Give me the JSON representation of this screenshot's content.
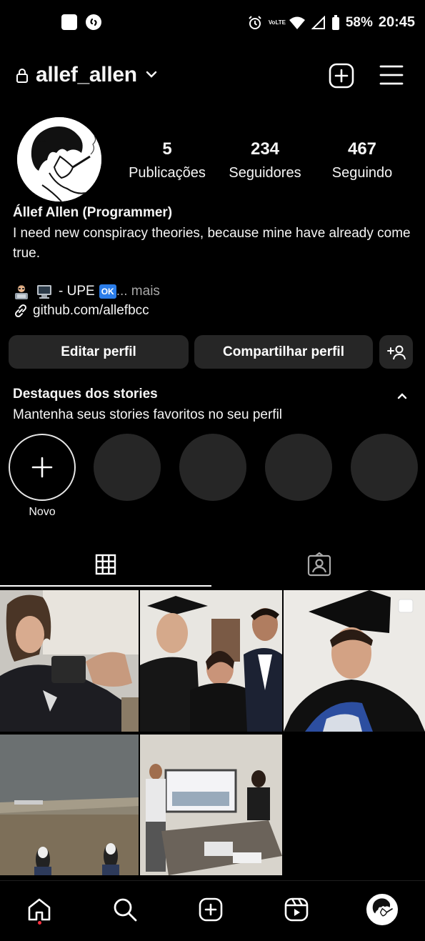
{
  "status_bar": {
    "battery": "58%",
    "time": "20:45",
    "volte": "VoLTE"
  },
  "header": {
    "username": "allef_allen",
    "icons": [
      "lock-icon",
      "chevron-down-icon",
      "new-post-icon",
      "menu-icon"
    ]
  },
  "profile": {
    "stats": [
      {
        "value": "5",
        "label": "Publicações"
      },
      {
        "value": "234",
        "label": "Seguidores"
      },
      {
        "value": "467",
        "label": "Seguindo"
      }
    ],
    "name": "Állef Allen (Programmer)",
    "bio": "I need new conspiracy theories, because mine have already come true.",
    "bio_line": "- UPE",
    "bio_ok": "OK",
    "bio_more": "... mais",
    "link": "github.com/allefbcc"
  },
  "buttons": {
    "edit": "Editar perfil",
    "share": "Compartilhar perfil"
  },
  "highlights": {
    "title": "Destaques dos stories",
    "subtitle": "Mantenha seus stories favoritos no seu perfil",
    "new_label": "Novo"
  },
  "tabs": [
    {
      "icon": "grid-icon",
      "active": true
    },
    {
      "icon": "tagged-icon",
      "active": false
    }
  ],
  "posts": [
    "photo-1",
    "photo-2",
    "photo-3",
    "photo-4",
    "photo-5"
  ],
  "bottom_nav": [
    "home-icon",
    "search-icon",
    "create-icon",
    "reels-icon",
    "profile-avatar"
  ],
  "colors": {
    "background": "#000000",
    "button": "#262626",
    "text": "#f5f5f5",
    "muted": "#a8a8a8",
    "notification_dot": "#ff3040",
    "ok_badge": "#2b7de9"
  }
}
